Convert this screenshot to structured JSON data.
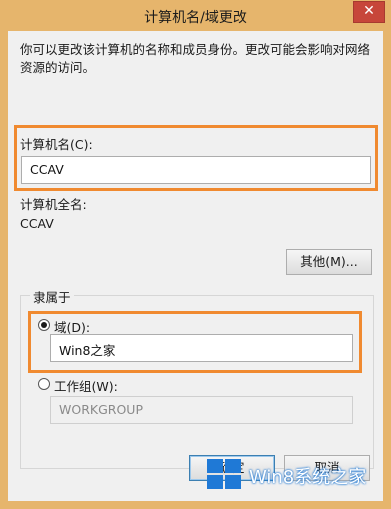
{
  "window": {
    "title": "计算机名/域更改",
    "close_symbol": "✕"
  },
  "description": "你可以更改该计算机的名称和成员身份。更改可能会影响对网络资源的访问。",
  "computer_name": {
    "label": "计算机名(C):",
    "value": "CCAV"
  },
  "full_name": {
    "label": "计算机全名:",
    "value": "CCAV"
  },
  "other_button": "其他(M)...",
  "member_of": {
    "legend": "隶属于",
    "domain_label": "域(D):",
    "domain_value": "Win8之家",
    "domain_selected": true,
    "workgroup_label": "工作组(W):",
    "workgroup_value": "WORKGROUP"
  },
  "buttons": {
    "ok": "确定",
    "cancel": "取消"
  },
  "watermark": "Win8系统之家",
  "colors": {
    "highlight": "#f08a30",
    "frame": "#e6b56c",
    "close": "#c7463a"
  }
}
